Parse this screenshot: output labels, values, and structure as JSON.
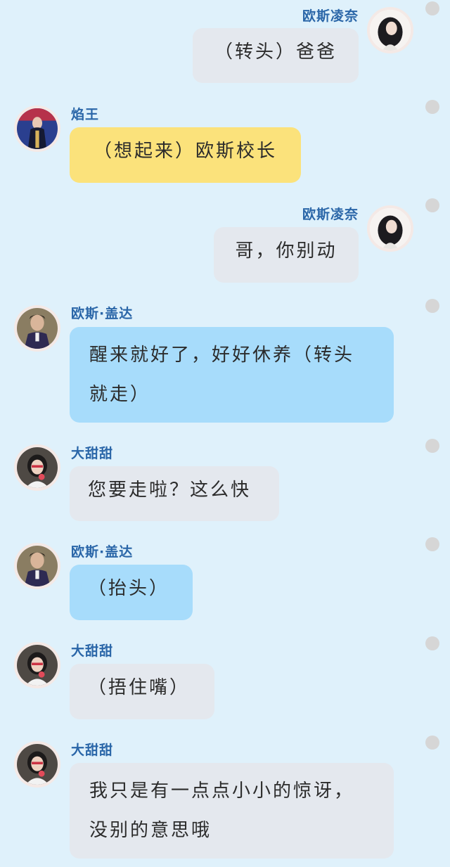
{
  "messages": [
    {
      "sender": "欧斯凌奈",
      "text": "（转头）爸爸",
      "side": "right",
      "bubble": "gray"
    },
    {
      "sender": "焰王",
      "text": "（想起来）欧斯校长",
      "side": "left",
      "bubble": "yellow"
    },
    {
      "sender": "欧斯凌奈",
      "text": "哥，你别动",
      "side": "right",
      "bubble": "gray"
    },
    {
      "sender": "欧斯·盖达",
      "text": "醒来就好了，好好休养（转头就走）",
      "side": "left",
      "bubble": "blue"
    },
    {
      "sender": "大甜甜",
      "text": "您要走啦？这么快",
      "side": "left",
      "bubble": "gray"
    },
    {
      "sender": "欧斯·盖达",
      "text": "（抬头）",
      "side": "left",
      "bubble": "blue"
    },
    {
      "sender": "大甜甜",
      "text": "（捂住嘴）",
      "side": "left",
      "bubble": "gray"
    },
    {
      "sender": "大甜甜",
      "text": "我只是有一点点小小的惊讶，没别的意思哦",
      "side": "left",
      "bubble": "gray"
    }
  ],
  "colors": {
    "background": "#dff1fb",
    "sender_name": "#2a66a8",
    "bubble_gray": "#e4e8ee",
    "bubble_yellow": "#fbe27b",
    "bubble_blue": "#a7dcfb",
    "status_dot": "#d6d6d6"
  }
}
